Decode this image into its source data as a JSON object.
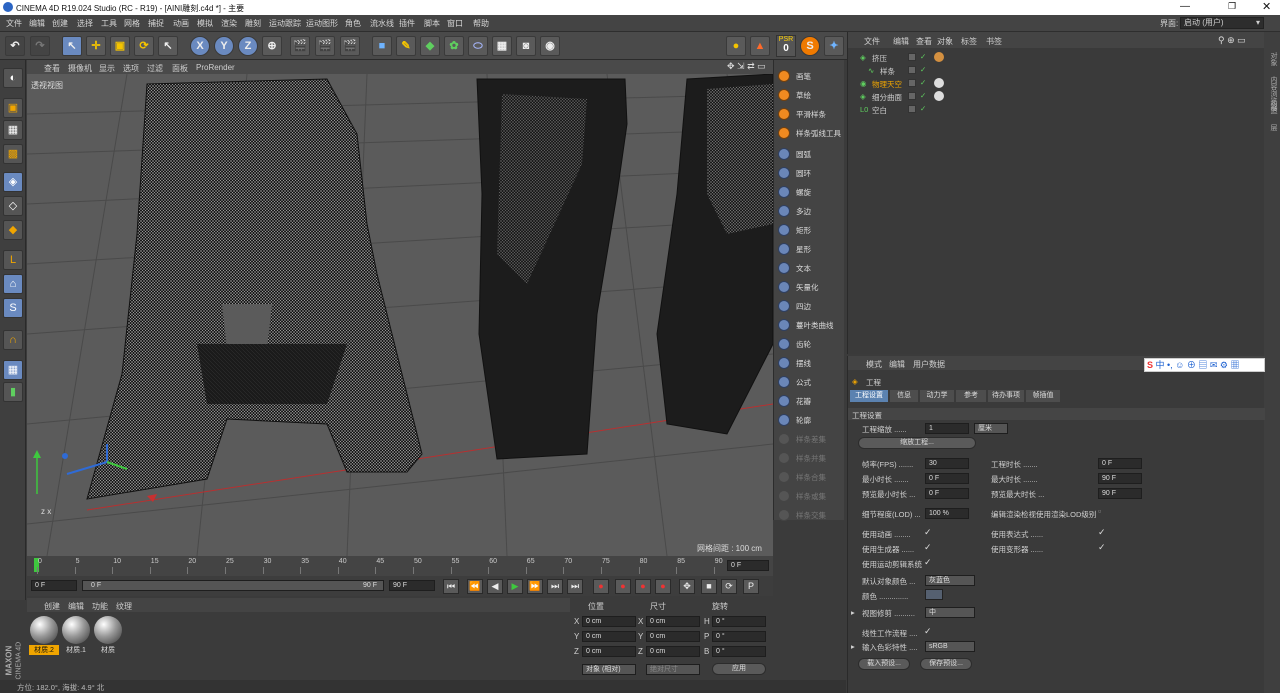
{
  "window": {
    "title": "CINEMA 4D R19.024 Studio (RC - R19) - [AINI雕刻.c4d *] - 主要"
  },
  "menu": [
    "文件",
    "编辑",
    "创建",
    "选择",
    "工具",
    "网格",
    "捕捉",
    "动画",
    "模拟",
    "渲染",
    "雕刻",
    "运动跟踪",
    "运动图形",
    "角色",
    "流水线",
    "插件",
    "脚本",
    "窗口",
    "帮助"
  ],
  "layout": {
    "label": "界面:",
    "value": "启动 (用户)"
  },
  "toolbar": {
    "psr": "PSR",
    "psr_value": "0",
    "tools": [
      "undo-icon",
      "redo-icon",
      "select-icon",
      "move-icon",
      "scale-icon",
      "rotate-icon",
      "live-select-icon",
      "x-axis-icon",
      "y-axis-icon",
      "z-axis-icon",
      "coord-icon",
      "render-view-icon",
      "render-region-icon",
      "render-settings-icon",
      "cube-icon",
      "pen-icon",
      "subdivide-icon",
      "array-icon",
      "deformer-icon",
      "floor-icon",
      "camera-icon",
      "light-icon"
    ]
  },
  "viewport": {
    "menu": [
      "查看",
      "摄像机",
      "显示",
      "选项",
      "过滤",
      "面板",
      "ProRender"
    ],
    "label": "透视视图",
    "grid_label": "网格间距 : 100 cm"
  },
  "spline_menu": {
    "items": [
      {
        "label": "画笔",
        "enabled": true
      },
      {
        "label": "草绘",
        "enabled": true
      },
      {
        "label": "平滑样条",
        "enabled": true
      },
      {
        "label": "样条弧线工具",
        "enabled": true
      },
      {
        "label": "圆弧",
        "enabled": true
      },
      {
        "label": "圆环",
        "enabled": true
      },
      {
        "label": "螺旋",
        "enabled": true
      },
      {
        "label": "多边",
        "enabled": true
      },
      {
        "label": "矩形",
        "enabled": true
      },
      {
        "label": "星形",
        "enabled": true
      },
      {
        "label": "文本",
        "enabled": true
      },
      {
        "label": "矢量化",
        "enabled": true
      },
      {
        "label": "四边",
        "enabled": true
      },
      {
        "label": "蔓叶类曲线",
        "enabled": true
      },
      {
        "label": "齿轮",
        "enabled": true
      },
      {
        "label": "摆线",
        "enabled": true
      },
      {
        "label": "公式",
        "enabled": true
      },
      {
        "label": "花瓣",
        "enabled": true
      },
      {
        "label": "轮廓",
        "enabled": true
      },
      {
        "label": "样条差集",
        "enabled": false
      },
      {
        "label": "样条并集",
        "enabled": false
      },
      {
        "label": "样条合集",
        "enabled": false
      },
      {
        "label": "样条或集",
        "enabled": false
      },
      {
        "label": "样条交集",
        "enabled": false
      }
    ]
  },
  "object_manager": {
    "menu": [
      "文件",
      "编辑",
      "查看",
      "对象",
      "标签",
      "书签"
    ],
    "objects": [
      {
        "name": "挤压",
        "color": "#cfcfcf"
      },
      {
        "name": "样条",
        "color": "#cfcfcf"
      },
      {
        "name": "物理天空",
        "color": "#f0a500"
      },
      {
        "name": "细分曲面",
        "color": "#cfcfcf"
      },
      {
        "name": "空白",
        "color": "#cfcfcf"
      }
    ]
  },
  "side_tabs": [
    "对象",
    "内容浏览器",
    "构造",
    "层"
  ],
  "attributes": {
    "menu": [
      "模式",
      "编辑",
      "用户数据"
    ],
    "section": "工程",
    "tabs": [
      "工程设置",
      "信息",
      "动力学",
      "参考",
      "待办事项",
      "帧插值"
    ],
    "group_title": "工程设置",
    "fields": {
      "scale_label": "工程缩放 ......",
      "scale_value": "1",
      "scale_unit": "厘米",
      "scale_button": "缩放工程...",
      "fps_label": "帧率(FPS) .......",
      "fps_value": "30",
      "project_time_label": "工程时长 .......",
      "project_time_value": "0 F",
      "min_time_label": "最小时长 .......",
      "min_time_value": "0 F",
      "max_time_label": "最大时长 .......",
      "max_time_value": "90 F",
      "preview_min_label": "预览最小时长 ...",
      "preview_min_value": "0 F",
      "preview_max_label": "预览最大时长 ...",
      "preview_max_value": "90 F",
      "lod_label": "细节程度(LOD) ...",
      "lod_value": "100 %",
      "lod_render_label": "编辑渲染检视使用渲染LOD级别",
      "use_anim_label": "使用动画 ........",
      "use_expr_label": "使用表达式 ......",
      "use_gen_label": "使用生成器 ......",
      "use_deform_label": "使用变形器 ......",
      "use_motion_label": "使用运动剪辑系统",
      "default_color_label": "默认对象颜色 ...",
      "default_color_value": "灰蓝色",
      "color_label": "颜色 ..............",
      "clip_label": "视图修剪 ..........",
      "clip_value": "中",
      "linear_label": "线性工作流程 ....",
      "input_color_label": "输入色彩特性 ....",
      "input_color_value": "sRGB",
      "load_preset": "载入预设...",
      "save_preset": "保存预设..."
    }
  },
  "timeline": {
    "ticks": [
      "0",
      "5",
      "10",
      "15",
      "20",
      "25",
      "30",
      "35",
      "40",
      "45",
      "50",
      "55",
      "60",
      "65",
      "70",
      "75",
      "80",
      "85",
      "90"
    ],
    "end_field": "0 F"
  },
  "transport": {
    "current": "0 F",
    "start": "0 F",
    "end_slider": "90 F",
    "end": "90 F"
  },
  "materials": {
    "menu": [
      "创建",
      "编辑",
      "功能",
      "纹理"
    ],
    "items": [
      "材质.2",
      "材质.1",
      "材质"
    ]
  },
  "coords": {
    "headers": [
      "位置",
      "尺寸",
      "旋转"
    ],
    "rows": [
      {
        "axis": "X",
        "pos": "0 cm",
        "size": "0 cm",
        "rot_axis": "H",
        "rot": "0 °"
      },
      {
        "axis": "Y",
        "pos": "0 cm",
        "size": "0 cm",
        "rot_axis": "P",
        "rot": "0 °"
      },
      {
        "axis": "Z",
        "pos": "0 cm",
        "size": "0 cm",
        "rot_axis": "B",
        "rot": "0 °"
      }
    ],
    "mode": "对象 (相对)",
    "size_mode": "绝对尺寸",
    "apply": "应用"
  },
  "status": {
    "text": "方位: 182.0°, 海拔: 4.9° 北"
  },
  "maxon": {
    "line1": "MAXON",
    "line2": "CINEMA 4D"
  }
}
